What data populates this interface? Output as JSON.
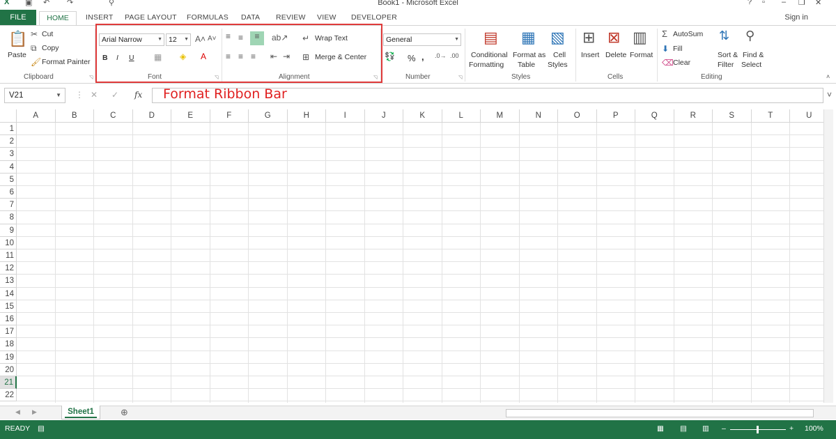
{
  "window": {
    "title": "Book1 - Microsoft Excel"
  },
  "tabs": {
    "file": "FILE",
    "home": "HOME",
    "others": [
      "INSERT",
      "PAGE LAYOUT",
      "FORMULAS",
      "DATA",
      "REVIEW",
      "VIEW",
      "DEVELOPER"
    ],
    "signin": "Sign in"
  },
  "ribbon": {
    "clipboard": {
      "paste": "Paste",
      "cut": "Cut",
      "copy": "Copy",
      "format_painter": "Format Painter",
      "label": "Clipboard"
    },
    "font": {
      "name": "Arial Narrow",
      "size": "12",
      "bold": "B",
      "italic": "I",
      "underline": "U",
      "label": "Font"
    },
    "alignment": {
      "wrap_text": "Wrap Text",
      "merge_center": "Merge & Center",
      "label": "Alignment"
    },
    "number": {
      "format": "General",
      "percent": "%",
      "comma": ",",
      "label": "Number"
    },
    "styles": {
      "conditional_1": "Conditional",
      "conditional_2": "Formatting",
      "format_as_1": "Format as",
      "format_as_2": "Table",
      "cell_styles_1": "Cell",
      "cell_styles_2": "Styles",
      "label": "Styles"
    },
    "cells": {
      "insert": "Insert",
      "delete": "Delete",
      "format": "Format",
      "label": "Cells"
    },
    "editing": {
      "autosum": "AutoSum",
      "fill": "Fill",
      "clear": "Clear",
      "sort_1": "Sort &",
      "sort_2": "Filter",
      "find_1": "Find &",
      "find_2": "Select",
      "label": "Editing"
    }
  },
  "formula_bar": {
    "name_box": "V21",
    "fx": "fx",
    "content": "Format Ribbon Bar"
  },
  "columns": [
    "A",
    "B",
    "C",
    "D",
    "E",
    "F",
    "G",
    "H",
    "I",
    "J",
    "K",
    "L",
    "M",
    "N",
    "O",
    "P",
    "Q",
    "R",
    "S",
    "T",
    "U"
  ],
  "rows": [
    "1",
    "2",
    "3",
    "4",
    "5",
    "6",
    "7",
    "8",
    "9",
    "10",
    "11",
    "12",
    "13",
    "14",
    "15",
    "16",
    "17",
    "18",
    "19",
    "20",
    "21",
    "22"
  ],
  "selected_row": "21",
  "sheets": [
    "Sheet1"
  ],
  "status": {
    "mode": "READY",
    "zoom": "100%"
  },
  "colors": {
    "excel_green": "#217346",
    "highlight_red": "#e03a3a"
  }
}
